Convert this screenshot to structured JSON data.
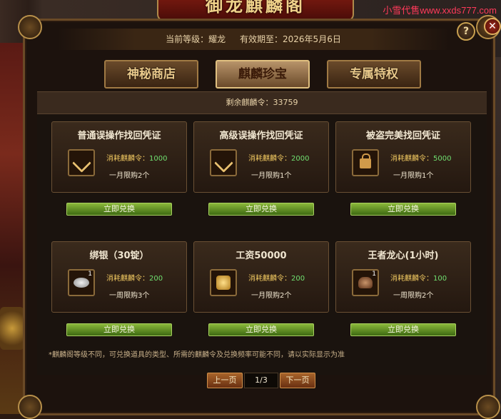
{
  "watermark": "小雪代售www.xxds777.com",
  "banner_title": "御龙麒麟阁",
  "header": {
    "level_label": "当前等级：耀龙",
    "expiry_label": "有效期至：2026年5月6日"
  },
  "tabs": [
    {
      "label": "神秘商店"
    },
    {
      "label": "麒麟珍宝"
    },
    {
      "label": "专属特权"
    }
  ],
  "active_tab": "麒麟珍宝",
  "remaining_text": "剩余麒麟令：33759",
  "cost_prefix": "消耗麒麟令：",
  "items": [
    {
      "title": "普通误操作找回凭证",
      "icon": "wrench-icon",
      "cost": "1000",
      "limit": "一月限购2个",
      "button": "立即兑换"
    },
    {
      "title": "高级误操作找回凭证",
      "icon": "wrench-icon",
      "cost": "2000",
      "limit": "一月限购1个",
      "button": "立即兑换"
    },
    {
      "title": "被盗完美找回凭证",
      "icon": "lock-icon",
      "cost": "5000",
      "limit": "一月限购1个",
      "button": "立即兑换"
    },
    {
      "title": "绑银（30锭）",
      "icon": "silver-ingot-icon",
      "qty": "1",
      "cost": "200",
      "limit": "一周限购3个",
      "button": "立即兑换"
    },
    {
      "title": "工资50000",
      "icon": "gold-coins-icon",
      "cost": "200",
      "limit": "一月限购2个",
      "button": "立即兑换"
    },
    {
      "title": "王者龙心(1小时)",
      "icon": "dragon-heart-icon",
      "qty": "1",
      "cost": "100",
      "limit": "一周限购2个",
      "button": "立即兑换"
    }
  ],
  "note": "*麒麟阁等级不同，可兑换道具的类型、所需的麒麟令及兑换频率可能不同，请以实际显示为准",
  "pager": {
    "prev": "上一页",
    "page": "1/3",
    "next": "下一页"
  },
  "help_label": "?",
  "close_label": "✕"
}
